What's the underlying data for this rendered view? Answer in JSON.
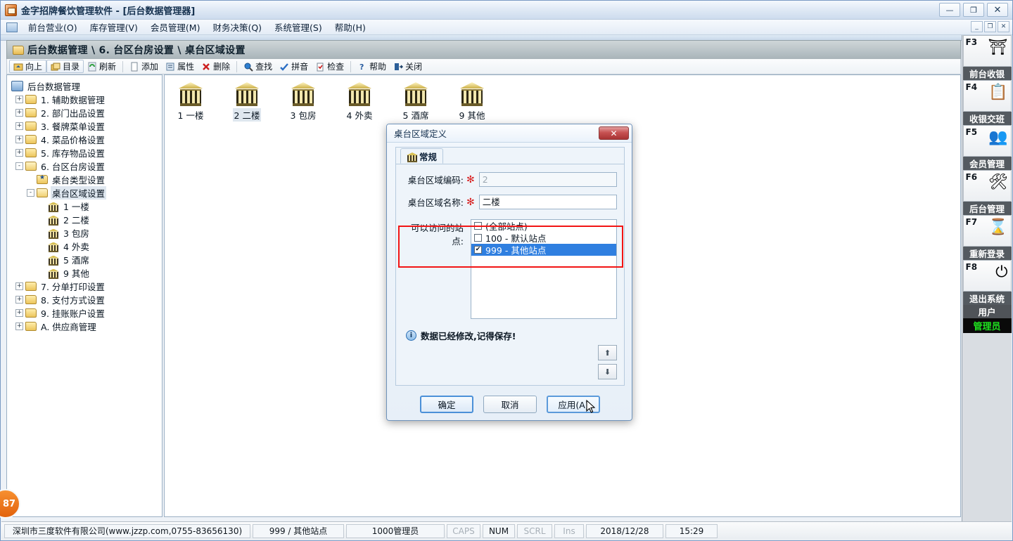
{
  "window": {
    "title": "金字招牌餐饮管理软件 - [后台数据管理器]",
    "minimize": "—",
    "maximize": "❐",
    "close": "✕",
    "mdi_minimize": "_",
    "mdi_restore": "❐",
    "mdi_close": "✕"
  },
  "menu": {
    "items": [
      {
        "label": "前台营业(O)"
      },
      {
        "label": "库存管理(V)"
      },
      {
        "label": "会员管理(M)"
      },
      {
        "label": "财务决策(Q)"
      },
      {
        "label": "系统管理(S)"
      },
      {
        "label": "帮助(H)"
      }
    ]
  },
  "breadcrumb": {
    "path": "后台数据管理 \\ 6. 台区台房设置 \\ 桌台区域设置"
  },
  "toolbar": {
    "groups": [
      [
        {
          "label": "向上",
          "icon": "up-folder-icon",
          "glyph": "⬆",
          "selected": false
        },
        {
          "label": "目录",
          "icon": "catalog-icon",
          "glyph": "📂",
          "selected": true
        },
        {
          "label": "刷新",
          "icon": "refresh-icon",
          "glyph": "♻",
          "selected": false
        }
      ],
      [
        {
          "label": "添加",
          "icon": "add-page-icon",
          "glyph": "📄",
          "selected": false
        },
        {
          "label": "属性",
          "icon": "properties-icon",
          "glyph": "📝",
          "selected": false
        },
        {
          "label": "删除",
          "icon": "delete-icon",
          "glyph": "✕",
          "selected": false
        }
      ],
      [
        {
          "label": "查找",
          "icon": "search-icon",
          "glyph": "🔍",
          "selected": false
        },
        {
          "label": "拼音",
          "icon": "spellcheck-icon",
          "glyph": "✔",
          "selected": false
        },
        {
          "label": "检查",
          "icon": "check-clipboard-icon",
          "glyph": "📋",
          "selected": false
        }
      ],
      [
        {
          "label": "帮助",
          "icon": "help-icon",
          "glyph": "❓",
          "selected": false
        },
        {
          "label": "关闭",
          "icon": "exit-icon",
          "glyph": "⏏",
          "selected": false
        }
      ]
    ]
  },
  "tree": {
    "root": {
      "label": "后台数据管理",
      "icon": "database-icon"
    },
    "nodes": [
      {
        "label": "1. 辅助数据管理",
        "depth": 1,
        "expander": "+",
        "icon": "folder"
      },
      {
        "label": "2. 部门出品设置",
        "depth": 1,
        "expander": "+",
        "icon": "folder"
      },
      {
        "label": "3. 餐牌菜单设置",
        "depth": 1,
        "expander": "+",
        "icon": "folder"
      },
      {
        "label": "4. 菜品价格设置",
        "depth": 1,
        "expander": "+",
        "icon": "folder"
      },
      {
        "label": "5. 库存物品设置",
        "depth": 1,
        "expander": "+",
        "icon": "folder"
      },
      {
        "label": "6. 台区台房设置",
        "depth": 1,
        "expander": "-",
        "icon": "folder-open"
      },
      {
        "label": "桌台类型设置",
        "depth": 2,
        "expander": "",
        "icon": "folder-star"
      },
      {
        "label": "桌台区域设置",
        "depth": 2,
        "expander": "-",
        "icon": "folder-open",
        "selected": true
      },
      {
        "label": "1 一楼",
        "depth": 3,
        "expander": "",
        "icon": "bank"
      },
      {
        "label": "2 二楼",
        "depth": 3,
        "expander": "",
        "icon": "bank"
      },
      {
        "label": "3 包房",
        "depth": 3,
        "expander": "",
        "icon": "bank"
      },
      {
        "label": "4 外卖",
        "depth": 3,
        "expander": "",
        "icon": "bank"
      },
      {
        "label": "5 酒席",
        "depth": 3,
        "expander": "",
        "icon": "bank"
      },
      {
        "label": "9 其他",
        "depth": 3,
        "expander": "",
        "icon": "bank"
      },
      {
        "label": "7. 分单打印设置",
        "depth": 1,
        "expander": "+",
        "icon": "folder"
      },
      {
        "label": "8. 支付方式设置",
        "depth": 1,
        "expander": "+",
        "icon": "folder"
      },
      {
        "label": "9. 挂账账户设置",
        "depth": 1,
        "expander": "+",
        "icon": "folder"
      },
      {
        "label": "A. 供应商管理",
        "depth": 1,
        "expander": "+",
        "icon": "folder"
      }
    ]
  },
  "content": {
    "items": [
      {
        "label": "1 一楼",
        "selected": false
      },
      {
        "label": "2 二楼",
        "selected": true
      },
      {
        "label": "3 包房",
        "selected": false
      },
      {
        "label": "4 外卖",
        "selected": false
      },
      {
        "label": "5 酒席",
        "selected": false
      },
      {
        "label": "9 其他",
        "selected": false
      }
    ]
  },
  "dialog": {
    "title": "桌台区域定义",
    "close_label": "✕",
    "tab": {
      "label": "常规",
      "icon": "bank-icon"
    },
    "fields": {
      "code_label": "桌台区域编码:",
      "code_value": "2",
      "code_required": "✻",
      "name_label": "桌台区域名称:",
      "name_value": "二楼",
      "name_required": "✻"
    },
    "sites": {
      "label": "可以访问的站点:",
      "items": [
        {
          "label": "(全部站点)",
          "checked": false,
          "selected": false
        },
        {
          "label": "100 - 默认站点",
          "checked": false,
          "selected": false
        },
        {
          "label": "999 - 其他站点",
          "checked": true,
          "selected": true
        }
      ]
    },
    "note": {
      "icon": "info-icon",
      "glyph": "i",
      "text": "数据已经修改,记得保存!"
    },
    "arrows": {
      "up": "⬆",
      "down": "⬇"
    },
    "buttons": {
      "ok": "确定",
      "cancel": "取消",
      "apply": "应用(A)"
    }
  },
  "sidebar": {
    "buttons": [
      {
        "key": "F3",
        "glyph": "⛩",
        "caption": "前台收银"
      },
      {
        "key": "F4",
        "glyph": "📋",
        "caption": "收银交班"
      },
      {
        "key": "F5",
        "glyph": "👥",
        "caption": "会员管理"
      },
      {
        "key": "F6",
        "glyph": "🛠",
        "caption": "后台管理"
      },
      {
        "key": "F7",
        "glyph": "⌛",
        "caption": "重新登录"
      },
      {
        "key": "F8",
        "glyph": "⏻",
        "caption": "退出系统"
      }
    ],
    "user_label": "用户",
    "user_name": "管理员"
  },
  "statusbar": {
    "company": "深圳市三度软件有限公司(www.jzzp.com,0755-83656130)",
    "station": "999 / 其他站点",
    "user": "1000管理员",
    "caps": "CAPS",
    "num": "NUM",
    "scrl": "SCRL",
    "ins": "Ins",
    "date": "2018/12/28",
    "time": "15:29"
  },
  "badge": {
    "value": "87"
  }
}
